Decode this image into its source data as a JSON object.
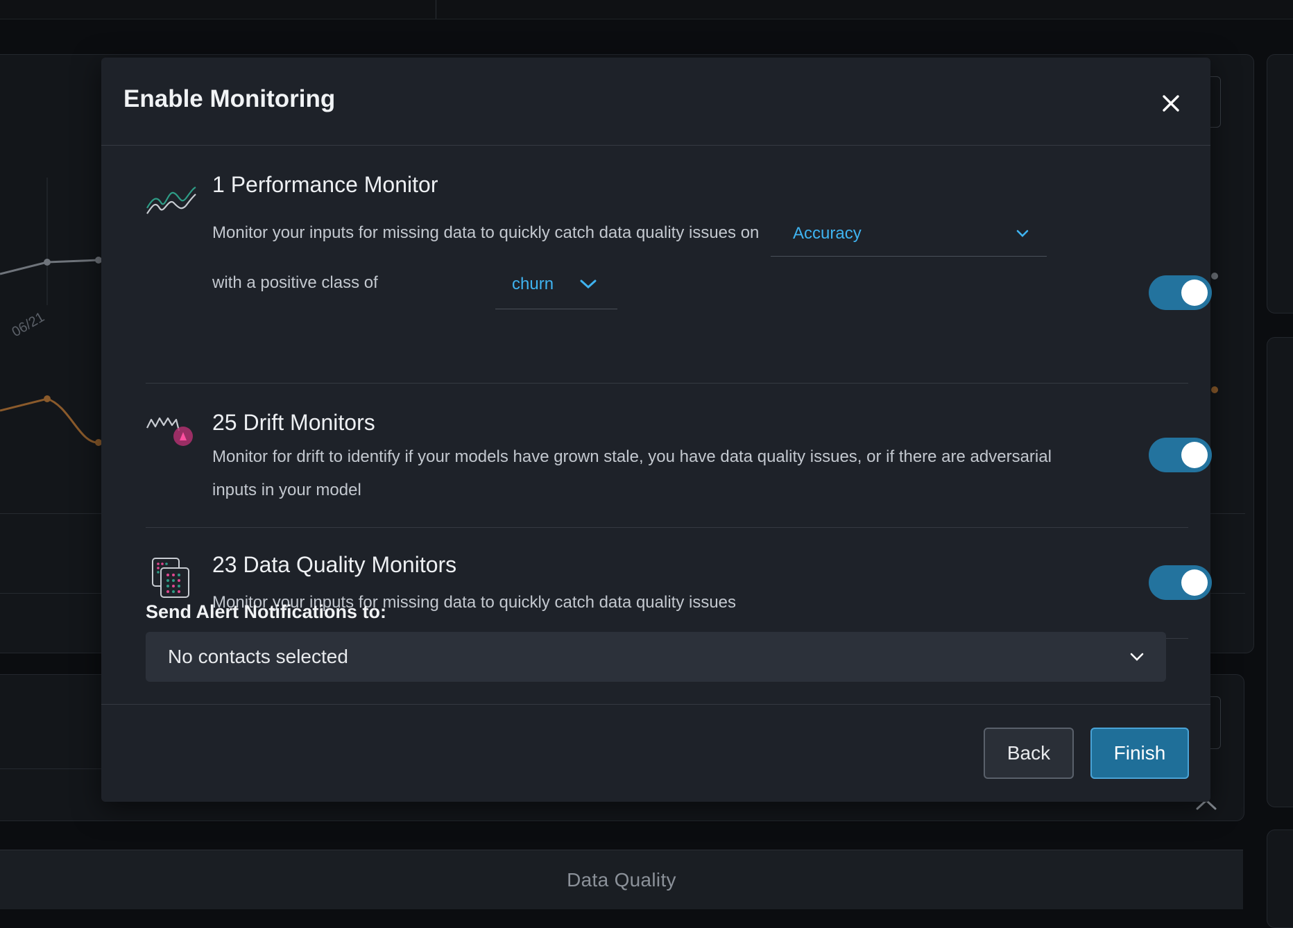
{
  "background": {
    "chart_tick_label": "06/21",
    "tab_label": "Data Quality"
  },
  "modal": {
    "title": "Enable Monitoring",
    "monitors": [
      {
        "title": "1 Performance Monitor",
        "description": "Monitor your inputs for missing data to quickly catch data quality issues on",
        "metric_select": "Accuracy",
        "class_prefix": "with a positive class of",
        "class_select": "churn",
        "enabled": true,
        "icon": "performance-wave-icon"
      },
      {
        "title": "25 Drift Monitors",
        "description": "Monitor for drift to identify if your models have grown stale, you have data quality issues, or if there are adversarial inputs in your model",
        "enabled": true,
        "icon": "drift-icon"
      },
      {
        "title": "23 Data Quality Monitors",
        "description": "Monitor your inputs for missing data to quickly catch data quality issues",
        "enabled": true,
        "icon": "data-quality-icon"
      }
    ],
    "alerts": {
      "label": "Send Alert Notifications to:",
      "contacts_value": "No contacts selected"
    },
    "buttons": {
      "back": "Back",
      "finish": "Finish"
    }
  },
  "colors": {
    "accent": "#3fb3f0",
    "toggle_on": "#23739e",
    "modal_bg": "#1e2229"
  }
}
